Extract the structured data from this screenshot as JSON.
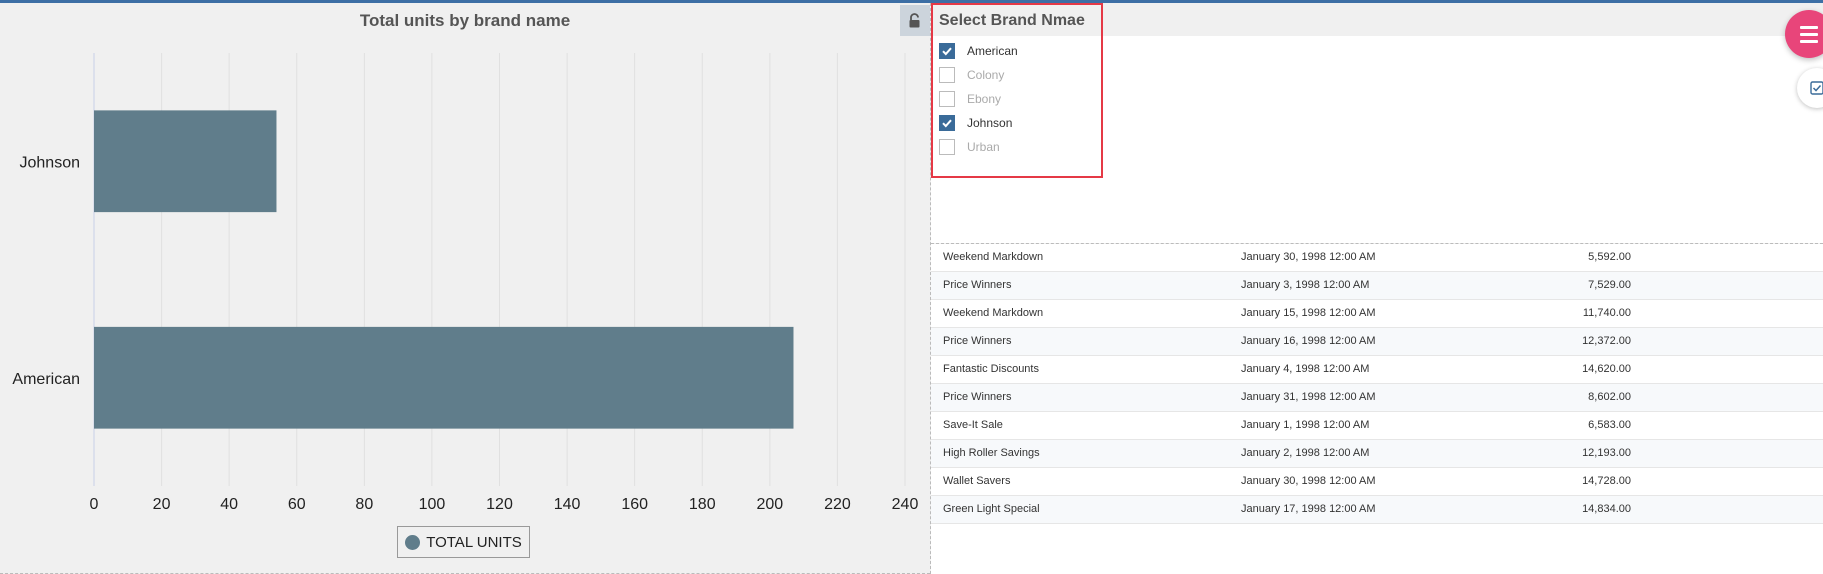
{
  "chart_data": {
    "type": "bar",
    "orientation": "horizontal",
    "title": "Total units by brand name",
    "categories": [
      "Johnson",
      "American"
    ],
    "series": [
      {
        "name": "TOTAL UNITS",
        "values": [
          54,
          207
        ]
      }
    ],
    "xlim": [
      0,
      240
    ],
    "xticks": [
      "0",
      "20",
      "40",
      "60",
      "80",
      "100",
      "120",
      "140",
      "160",
      "180",
      "200",
      "220",
      "240"
    ],
    "grid": true,
    "legend_placement": "bottom-center",
    "bar_color": "#607d8b"
  },
  "filter": {
    "title": "Select Brand Nmae",
    "items": [
      {
        "label": "American",
        "checked": true
      },
      {
        "label": "Colony",
        "checked": false
      },
      {
        "label": "Ebony",
        "checked": false
      },
      {
        "label": "Johnson",
        "checked": true
      },
      {
        "label": "Urban",
        "checked": false
      }
    ]
  },
  "table": {
    "rows": [
      [
        "Weekend Markdown",
        "January 30, 1998 12:00 AM",
        "5,592.00"
      ],
      [
        "Price Winners",
        "January 3, 1998 12:00 AM",
        "7,529.00"
      ],
      [
        "Weekend Markdown",
        "January 15, 1998 12:00 AM",
        "11,740.00"
      ],
      [
        "Price Winners",
        "January 16, 1998 12:00 AM",
        "12,372.00"
      ],
      [
        "Fantastic Discounts",
        "January 4, 1998 12:00 AM",
        "14,620.00"
      ],
      [
        "Price Winners",
        "January 31, 1998 12:00 AM",
        "8,602.00"
      ],
      [
        "Save-It Sale",
        "January 1, 1998 12:00 AM",
        "6,583.00"
      ],
      [
        "High Roller Savings",
        "January 2, 1998 12:00 AM",
        "12,193.00"
      ],
      [
        "Wallet Savers",
        "January 30, 1998 12:00 AM",
        "14,728.00"
      ],
      [
        "Green Light Special",
        "January 17, 1998 12:00 AM",
        "14,834.00"
      ]
    ]
  },
  "icons": {
    "lock": "unlock-icon",
    "menu": "hamburger-menu-icon",
    "select": "checkbox-icon"
  },
  "colors": {
    "accent": "#3d6fa5",
    "checkbox": "#3a6b99",
    "highlight": "#e53946",
    "fab": "#e8457a"
  }
}
